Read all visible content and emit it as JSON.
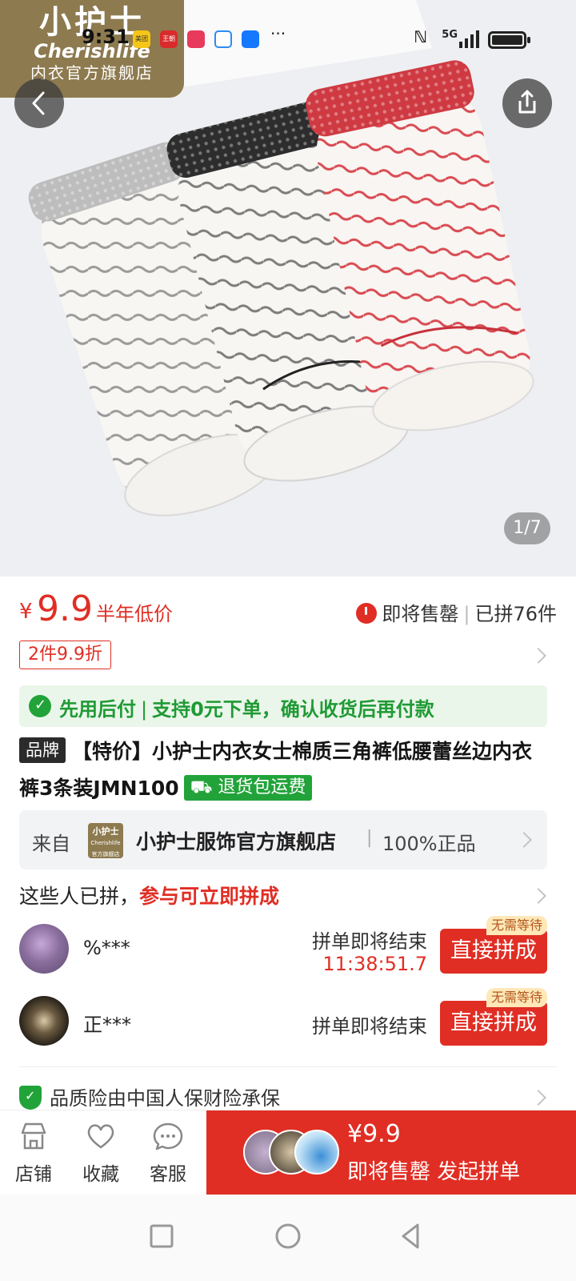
{
  "status_bar": {
    "time": "9:31",
    "apps": [
      {
        "name": "meituan-icon",
        "label": "美团",
        "color": "#f5c518"
      },
      {
        "name": "wangchao-icon",
        "label": "王朝",
        "color": "#d92b2b"
      },
      {
        "name": "love-app-icon",
        "label": "",
        "color": "#e83a5c"
      },
      {
        "name": "chat-app-icon",
        "label": "",
        "color": "#2d8cf0"
      },
      {
        "name": "bot-app-icon",
        "label": "",
        "color": "#1677ff"
      }
    ],
    "more": "···",
    "network": "5G"
  },
  "hero": {
    "brand_logo": {
      "line1": "小护士",
      "line2": "Cherishlife",
      "line3": "内衣官方旗舰店"
    },
    "image_counter": "1/7"
  },
  "price": {
    "currency": "¥",
    "value": "9.9",
    "tag": "半年低价",
    "status": "即将售罄",
    "sold": "已拼76件",
    "discount": "2件9.9折"
  },
  "pay_later": {
    "main": "先用后付",
    "detail": "支持0元下单，确认收货后再付款"
  },
  "product": {
    "brand_badge": "品牌",
    "title": "【特价】小护士内衣女士棉质三角裤低腰蕾丝边内衣裤3条装JMN100",
    "return_badge": "退货包运费"
  },
  "store": {
    "from": "来自",
    "logo_line1": "小护士",
    "logo_line2": "Cherishlife",
    "logo_line3": "官方旗舰店",
    "name": "小护士服饰官方旗舰店",
    "genuine": "100%正品"
  },
  "group": {
    "head_prefix": "这些人已拼，",
    "head_highlight": "参与可立即拼成",
    "items": [
      {
        "user": "%***",
        "ending": "拼单即将结束",
        "countdown": "11:38:51.7",
        "badge": "无需等待",
        "button": "直接拼成"
      },
      {
        "user": "正***",
        "ending": "拼单即将结束",
        "countdown": "",
        "badge": "无需等待",
        "button": "直接拼成"
      }
    ]
  },
  "insurance": "品质险由中国人保财险承保",
  "bottom_bar": {
    "tabs": [
      {
        "label": "店铺",
        "icon": "store-icon"
      },
      {
        "label": "收藏",
        "icon": "heart-icon"
      },
      {
        "label": "客服",
        "icon": "chat-icon"
      }
    ],
    "cta_price": "¥9.9",
    "cta_text": "即将售罄 发起拼单"
  },
  "colors": {
    "accent": "#e02e24",
    "green": "#22a33a",
    "brand": "#8d7a4f"
  }
}
